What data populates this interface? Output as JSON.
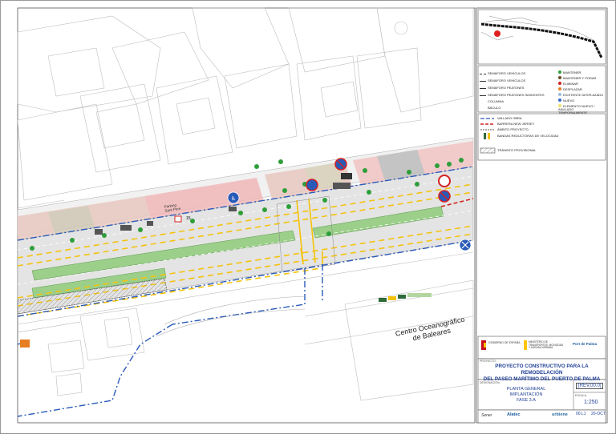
{
  "map": {
    "street_name_parking": "Parking Sant Pere",
    "building_label_line1": "Centro Oceanográfico",
    "building_label_line2": "de Baleares",
    "speed_limit_text": "15",
    "road_sign_text": "P"
  },
  "legend_symbols": {
    "items_left": [
      "SEMÁFORO VEHÍCULOS",
      "SEMÁFORO VEHÍCULOS",
      "SEMÁFORO PEATONES",
      "SEMÁFORO PEATONES INVIDENTES",
      "COLUMNA",
      "BÁCULO"
    ],
    "items_right": [
      "MANTENER",
      "MANTENER Y PODAR",
      "ELIMINAR",
      "DESPLAZAR",
      "EXISTENTE DESPLAZADO",
      "NUEVO",
      "ELEMENTO NUEVO / ANULADO TEMPORALMENTE"
    ],
    "right_colors": [
      "#2e9e3a",
      "#6b4a2a",
      "#c22",
      "#e67e22",
      "#9bd",
      "#36c",
      "#f1e36b"
    ]
  },
  "legend_works": {
    "items": [
      "VALLADO OBRA",
      "BARRERA NEW JERSEY",
      "ÁMBITO PROYECTO",
      "BANDAS REDUCTORAS DE VELOCIDAD",
      "TRÁNSITO PROVISIONAL"
    ]
  },
  "title_block": {
    "client": "GOBIERNO DE ESPAÑA",
    "ministry": "MINISTERIO DE TRANSPORTES, MOVILIDAD Y AGENDA URBANA",
    "port_authority": "Port de Palma",
    "project_caption": "PROYECTO:",
    "project_title_line1": "PROYECTO CONSTRUCTIVO PARA LA REMODELACIÓN",
    "project_title_line2": "DEL PASEO MARÍTIMO DEL PUERTO DE PALMA",
    "designation_caption": "DESIGNACIÓN:",
    "plan_line1": "PLANTA GENERAL",
    "plan_line2": "IMPLANTACIÓN",
    "plan_line3": "FASE 3.A",
    "revision": "REV.00.0",
    "scale_caption": "ESCALA:",
    "scale": "1:250",
    "sheet_number": "00.L1",
    "date": "20-OCT",
    "logos": [
      "Sener",
      "Alatec",
      "urbiene"
    ]
  },
  "colors": {
    "frame": "#444",
    "green_strip": "#9ccf8a",
    "asphalt": "#e6e6e6",
    "yellow_line": "#f4c20d",
    "blue_fence": "#2a5ab8",
    "red_barrier": "#d42020",
    "work_zone": "#f2c6c6"
  }
}
